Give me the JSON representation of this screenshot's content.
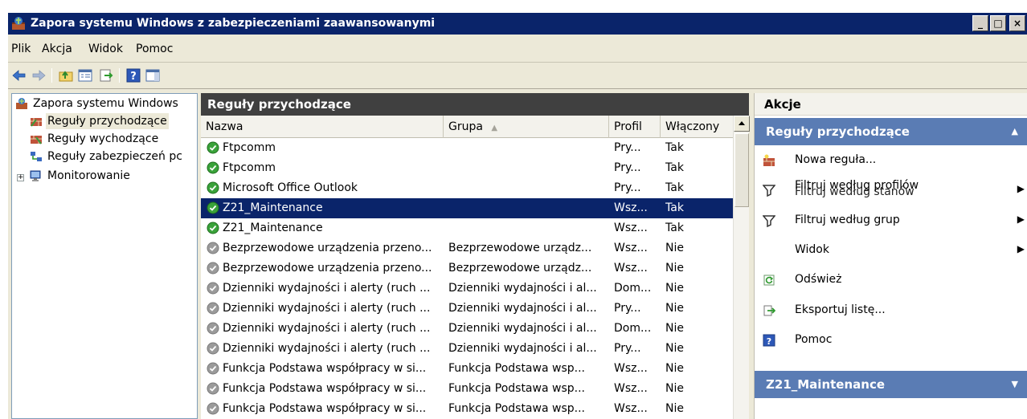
{
  "window": {
    "title": "Zapora systemu Windows z zabezpieczeniami zaawansowanymi",
    "controls": {
      "minimize": "_",
      "maximize": "□",
      "close": "×"
    }
  },
  "menu": [
    {
      "label": "Plik"
    },
    {
      "label": "Akcja"
    },
    {
      "label": "Widok"
    },
    {
      "label": "Pomoc"
    }
  ],
  "tree": {
    "root": "Zapora systemu Windows",
    "items": [
      {
        "label": "Reguły przychodzące",
        "selected": true
      },
      {
        "label": "Reguły wychodzące"
      },
      {
        "label": "Reguły zabezpieczeń pc"
      }
    ],
    "monitoring": {
      "label": "Monitorowanie",
      "expander": "+"
    }
  },
  "center": {
    "title": "Reguły przychodzące",
    "columns": [
      "Nazwa",
      "Grupa",
      "Profil",
      "Włączony"
    ],
    "sort_indicator": "▲",
    "rows": [
      {
        "name": "Ftpcomm",
        "group": "",
        "profile": "Pry...",
        "enabled": "Tak",
        "status": "green"
      },
      {
        "name": "Ftpcomm",
        "group": "",
        "profile": "Pry...",
        "enabled": "Tak",
        "status": "green"
      },
      {
        "name": "Microsoft Office Outlook",
        "group": "",
        "profile": "Pry...",
        "enabled": "Tak",
        "status": "green"
      },
      {
        "name": "Z21_Maintenance",
        "group": "",
        "profile": "Wsz...",
        "enabled": "Tak",
        "status": "green",
        "selected": true
      },
      {
        "name": "Z21_Maintenance",
        "group": "",
        "profile": "Wsz...",
        "enabled": "Tak",
        "status": "green"
      },
      {
        "name": "Bezprzewodowe urządzenia przeno...",
        "group": "Bezprzewodowe urządz...",
        "profile": "Wsz...",
        "enabled": "Nie",
        "status": "gray"
      },
      {
        "name": "Bezprzewodowe urządzenia przeno...",
        "group": "Bezprzewodowe urządz...",
        "profile": "Wsz...",
        "enabled": "Nie",
        "status": "gray"
      },
      {
        "name": "Dzienniki wydajności i alerty (ruch ...",
        "group": "Dzienniki wydajności i al...",
        "profile": "Dom...",
        "enabled": "Nie",
        "status": "gray"
      },
      {
        "name": "Dzienniki wydajności i alerty (ruch ...",
        "group": "Dzienniki wydajności i al...",
        "profile": "Pry...",
        "enabled": "Nie",
        "status": "gray"
      },
      {
        "name": "Dzienniki wydajności i alerty (ruch ...",
        "group": "Dzienniki wydajności i al...",
        "profile": "Dom...",
        "enabled": "Nie",
        "status": "gray"
      },
      {
        "name": "Dzienniki wydajności i alerty (ruch ...",
        "group": "Dzienniki wydajności i al...",
        "profile": "Pry...",
        "enabled": "Nie",
        "status": "gray"
      },
      {
        "name": "Funkcja Podstawa współpracy w si...",
        "group": "Funkcja Podstawa wsp...",
        "profile": "Wsz...",
        "enabled": "Nie",
        "status": "gray"
      },
      {
        "name": "Funkcja Podstawa współpracy w si...",
        "group": "Funkcja Podstawa wsp...",
        "profile": "Wsz...",
        "enabled": "Nie",
        "status": "gray"
      },
      {
        "name": "Funkcja Podstawa współpracy w si...",
        "group": "Funkcja Podstawa wsp...",
        "profile": "Wsz...",
        "enabled": "Nie",
        "status": "gray"
      }
    ]
  },
  "actions": {
    "header": "Akcje",
    "section1": {
      "title": "Reguły przychodzące",
      "arrow": "▲"
    },
    "items": [
      {
        "label": "Nowa reguła...",
        "icon": "new-rule-icon"
      },
      {
        "label": "Filtruj według profilów",
        "overlap": "Filtruj według stanów",
        "icon": "filter-icon",
        "submenu": "▶"
      },
      {
        "label": "Filtruj według grup",
        "icon": "filter-icon",
        "submenu": "▶"
      },
      {
        "label": "Widok",
        "icon": "",
        "submenu": "▶"
      },
      {
        "label": "Odśwież",
        "icon": "refresh-icon"
      },
      {
        "label": "Eksportuj listę...",
        "icon": "export-icon"
      },
      {
        "label": "Pomoc",
        "icon": "help-icon"
      }
    ],
    "section2": {
      "title": "Z21_Maintenance",
      "arrow": "▼"
    }
  },
  "colors": {
    "title_bar": "#0a246a",
    "selection": "#0a246a",
    "pane_header": "#404040",
    "action_section": "#5a7cb4",
    "status_enabled": "#3aa23a",
    "status_disabled": "#9a9a9a"
  }
}
